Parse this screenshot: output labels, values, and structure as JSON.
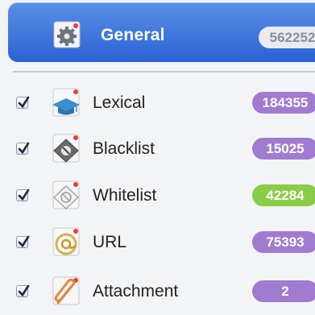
{
  "header": {
    "label": "General",
    "count": "562252",
    "icon": "gear-icon"
  },
  "filters": [
    {
      "label": "Lexical",
      "count": "184355",
      "checked": true,
      "icon": "graduation-cap-icon",
      "badge_color": "#a07bd0"
    },
    {
      "label": "Blacklist",
      "count": "15025",
      "checked": true,
      "icon": "blacklist-shield-icon",
      "badge_color": "#a07bd0"
    },
    {
      "label": "Whitelist",
      "count": "42284",
      "checked": true,
      "icon": "whitelist-shield-icon",
      "badge_color": "#8acc45"
    },
    {
      "label": "URL",
      "count": "75393",
      "checked": true,
      "icon": "at-sign-icon",
      "badge_color": "#a07bd0"
    },
    {
      "label": "Attachment",
      "count": "2",
      "checked": true,
      "icon": "paperclip-icon",
      "badge_color": "#a07bd0"
    }
  ],
  "colors": {
    "selection": "#2b62d4",
    "badge_purple": "#a07bd0",
    "badge_green": "#8acc45"
  }
}
